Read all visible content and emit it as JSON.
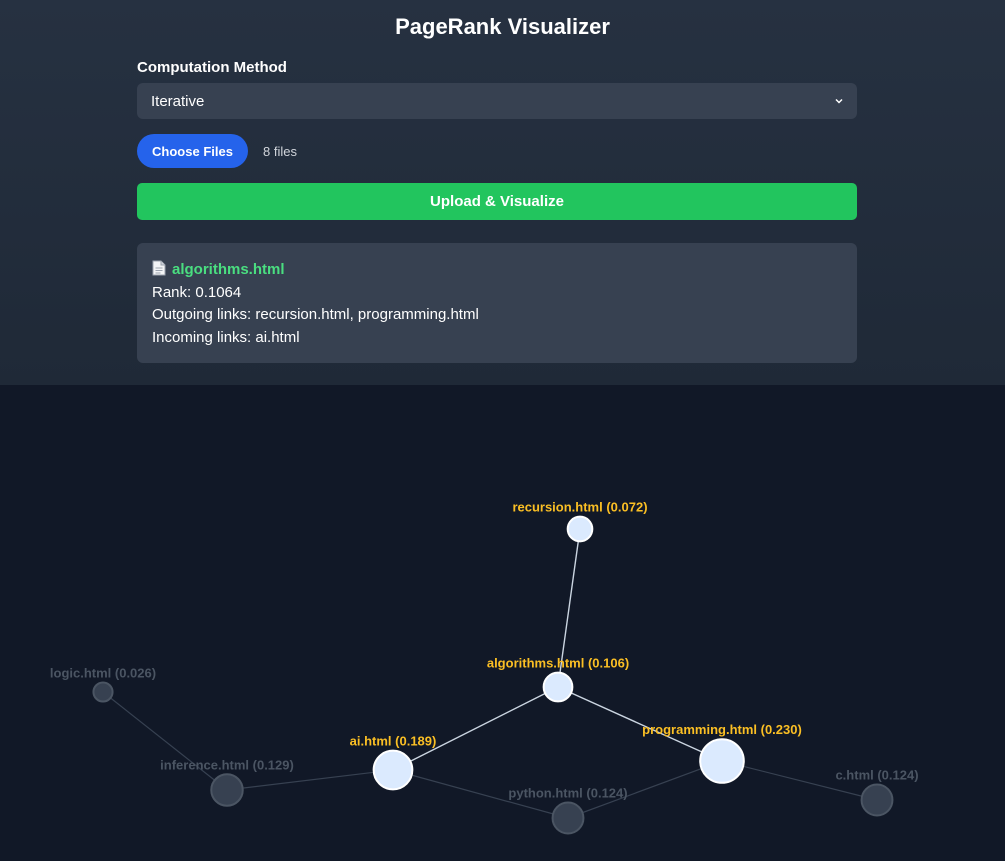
{
  "app": {
    "title": "PageRank Visualizer"
  },
  "controls": {
    "method_label": "Computation Method",
    "method_value": "Iterative",
    "choose_files_label": "Choose Files",
    "file_count": "8 files",
    "upload_label": "Upload & Visualize"
  },
  "info": {
    "filename": "algorithms.html",
    "rank": "Rank: 0.1064",
    "outgoing": "Outgoing links: recursion.html, programming.html",
    "incoming": "Incoming links: ai.html"
  },
  "graph": {
    "nodes": [
      {
        "id": "recursion",
        "label": "recursion.html (0.072)",
        "rank": 0.072,
        "highlighted": true
      },
      {
        "id": "algorithms",
        "label": "algorithms.html (0.106)",
        "rank": 0.106,
        "highlighted": true
      },
      {
        "id": "ai",
        "label": "ai.html (0.189)",
        "rank": 0.189,
        "highlighted": true
      },
      {
        "id": "programming",
        "label": "programming.html (0.230)",
        "rank": 0.23,
        "highlighted": true
      },
      {
        "id": "logic",
        "label": "logic.html (0.026)",
        "rank": 0.026,
        "highlighted": false
      },
      {
        "id": "inference",
        "label": "inference.html (0.129)",
        "rank": 0.129,
        "highlighted": false
      },
      {
        "id": "python",
        "label": "python.html (0.124)",
        "rank": 0.124,
        "highlighted": false
      },
      {
        "id": "c",
        "label": "c.html (0.124)",
        "rank": 0.124,
        "highlighted": false
      }
    ],
    "edges": [
      {
        "from": "algorithms",
        "to": "recursion",
        "highlighted": true
      },
      {
        "from": "ai",
        "to": "algorithms",
        "highlighted": true
      },
      {
        "from": "algorithms",
        "to": "programming",
        "highlighted": true
      },
      {
        "from": "logic",
        "to": "inference",
        "highlighted": false
      },
      {
        "from": "inference",
        "to": "ai",
        "highlighted": false
      },
      {
        "from": "ai",
        "to": "python",
        "highlighted": false
      },
      {
        "from": "python",
        "to": "programming",
        "highlighted": false
      },
      {
        "from": "programming",
        "to": "c",
        "highlighted": false
      }
    ]
  },
  "colors": {
    "label_active": "#fbbf24",
    "label_dim": "#4b5563",
    "edge_active": "#cbd5e1",
    "edge_dim": "#374151",
    "node_active_fill": "#dbeafe",
    "node_active_stroke": "#ffffff",
    "node_dim_fill": "#374151",
    "node_dim_stroke": "#4b5563"
  }
}
